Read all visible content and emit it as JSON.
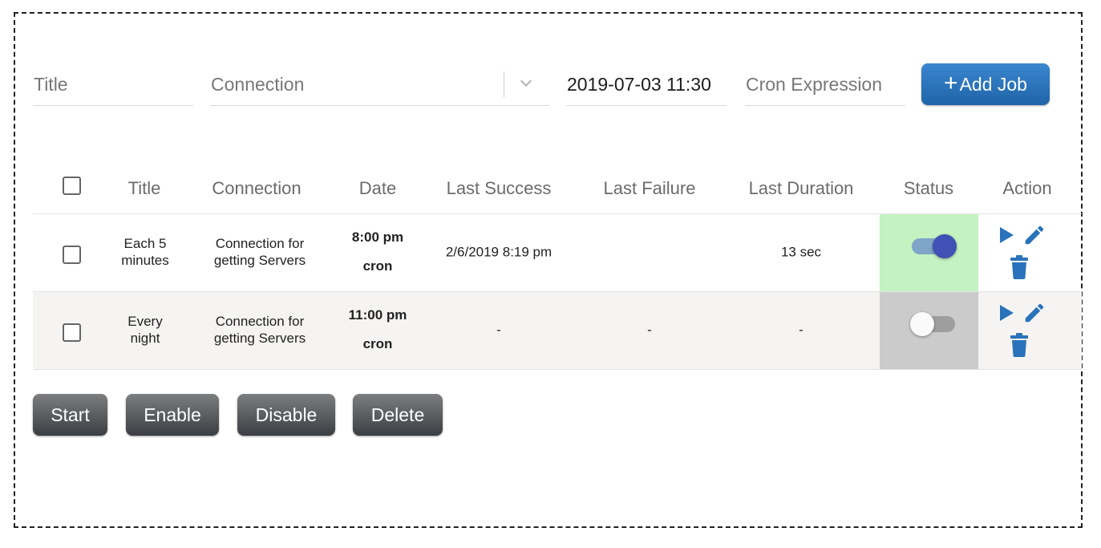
{
  "form": {
    "title_placeholder": "Title",
    "connection_placeholder": "Connection",
    "date_value": "2019-07-03 11:30",
    "cron_placeholder": "Cron Expression",
    "add_job_label": "Add Job",
    "add_job_icon": "plus-icon"
  },
  "table": {
    "headers": {
      "title": "Title",
      "connection": "Connection",
      "date": "Date",
      "last_success": "Last Success",
      "last_failure": "Last Failure",
      "last_duration": "Last Duration",
      "status": "Status",
      "action": "Action"
    },
    "rows": [
      {
        "title": "Each 5\nminutes",
        "connection": "Connection for\ngetting Servers",
        "time": "8:00 pm",
        "type": "cron",
        "last_success": "2/6/2019 8:19 pm",
        "last_failure": "",
        "last_duration": "13 sec",
        "status_enabled": true,
        "status_color": "#c4f3c1"
      },
      {
        "title": "Every\nnight",
        "connection": "Connection for\ngetting Servers",
        "time": "11:00 pm",
        "type": "cron",
        "last_success": "-",
        "last_failure": "-",
        "last_duration": "-",
        "status_enabled": false,
        "status_color": "#cbcbcb"
      }
    ],
    "action_icons": [
      "play-icon",
      "pencil-icon",
      "trash-icon"
    ]
  },
  "buttons": {
    "start": "Start",
    "enable": "Enable",
    "disable": "Disable",
    "delete": "Delete"
  },
  "colors": {
    "primary_button": "#2a73bb",
    "action_icon": "#2a73bb",
    "toggle_on": "#3f51b5"
  }
}
